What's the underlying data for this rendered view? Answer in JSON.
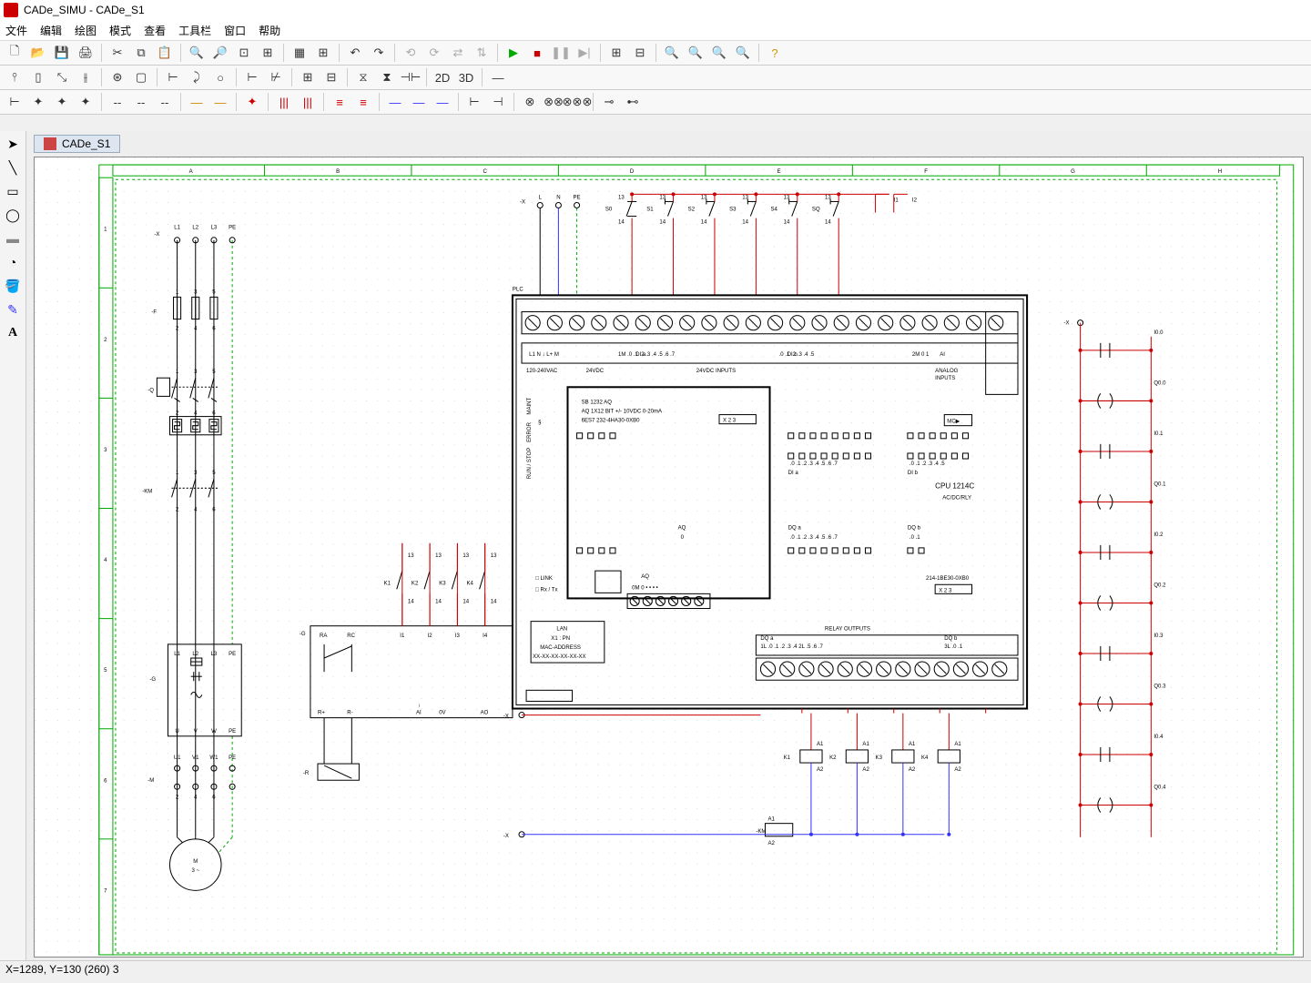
{
  "window_title": "CADe_SIMU - CADe_S1",
  "menu": [
    "文件",
    "编辑",
    "绘图",
    "模式",
    "查看",
    "工具栏",
    "窗口",
    "帮助"
  ],
  "doc_tab": "CADe_S1",
  "status": "X=1289, Y=130 (260) 3",
  "ruler_cols": [
    "A",
    "B",
    "C",
    "D",
    "E",
    "F",
    "G",
    "H"
  ],
  "ruler_rows": [
    "1",
    "2",
    "3",
    "4",
    "5",
    "6",
    "7"
  ],
  "power": {
    "conn": "-X",
    "phases": [
      "L1",
      "L2",
      "L3",
      "PE"
    ],
    "fuse_top": [
      "1",
      "3",
      "5"
    ],
    "fuse_bot": [
      "2",
      "4",
      "6"
    ],
    "fuse_lbl": "-F",
    "breaker_lbl": "-Q",
    "breaker_top": [
      "1",
      "3",
      "5"
    ],
    "breaker_bot": [
      "2",
      "4",
      "6"
    ],
    "km_lbl": "-KM",
    "km_top": [
      "1",
      "3",
      "5"
    ],
    "km_bot": [
      "2",
      "4",
      "6"
    ],
    "vfd_in": [
      "L1",
      "L2",
      "L3",
      "PE"
    ],
    "vfd_out": [
      "U",
      "V",
      "W",
      "PE"
    ],
    "vfd_lbl": "-G",
    "motor_u": [
      "U1",
      "V1",
      "W1",
      "PE"
    ],
    "motor_b": [
      "2",
      "4",
      "6"
    ],
    "motor_lbl": "-M",
    "motor_txt": "M\n3 ~"
  },
  "vfd_ctrl": {
    "lbl": "-G",
    "k_left": [
      "K1",
      "K2",
      "K3",
      "K4"
    ],
    "k_t": "13",
    "k_b": "14",
    "term_l": [
      "RA",
      "RC"
    ],
    "term_r": [
      "I1",
      "I2",
      "I3",
      "I4"
    ],
    "out_l": [
      "R+",
      "R-"
    ],
    "out_r": [
      "AI",
      "0V",
      "AO"
    ],
    "ai_arrow": "↓",
    "bot_lbl": "-R"
  },
  "plc_power": {
    "conn": "-X",
    "labels": [
      "L",
      "N",
      "PE"
    ]
  },
  "plc_inputs": {
    "switches": [
      "S0",
      "S1",
      "S2",
      "S3",
      "S4",
      "SQ"
    ],
    "pin_t": "13",
    "pin_b": "14",
    "right": [
      "I1",
      "I2"
    ]
  },
  "plc": {
    "lbl": "PLC",
    "power_row": [
      "L1",
      "N",
      "↓",
      "L+",
      "M"
    ],
    "power_l": "120-240VAC",
    "power_r": "24VDC",
    "di_hdr": "24VDC INPUTS",
    "dia": "DI a",
    "dib": "DI b",
    "di_a": [
      "1M",
      ".0",
      ".1",
      ".2",
      ".3",
      ".4",
      ".5",
      ".6",
      ".7"
    ],
    "di_b": [
      ".0",
      ".1",
      ".2",
      ".3",
      ".4",
      ".5"
    ],
    "ai_hdr": "ANALOG\nINPUTS",
    "ai": [
      "2M",
      "0",
      "1"
    ],
    "ai_lbl": "AI",
    "sb_title": "SB 1232 AQ",
    "sb_l2": "AQ 1X12 BIT +/- 10VDC 0-20mA",
    "sb_l3": "6ES7 232-4HA30-0XB0",
    "sb_x23": "X 2 3",
    "side": "RUN / STOP\nERROR\nMAINT",
    "cpu": "CPU 1214C",
    "cpu2": "AC/DC/RLY",
    "mc": "MC▶",
    "dia2": "DI a",
    "dib2": "DI b",
    "dia2_p": [
      ".0",
      ".1",
      ".2",
      ".3",
      ".4",
      ".5",
      ".6",
      ".7"
    ],
    "dib2_p": [
      ".0",
      ".1",
      ".2",
      ".3",
      ".4",
      ".5"
    ],
    "dqa": "DQ a",
    "dqb": "DQ b",
    "dqa_p": [
      ".0",
      ".1",
      ".2",
      ".3",
      ".4",
      ".5",
      ".6",
      ".7"
    ],
    "dqb_p": [
      ".0",
      ".1"
    ],
    "aq": "AQ",
    "aq0": "0",
    "link": "□ LINK",
    "rxtx": "□ Rx / Tx",
    "aq_row": [
      "0M",
      "0",
      "•",
      "•",
      "•",
      "•"
    ],
    "part": "214-1BE30-0XB0",
    "x23b": "X 2 3",
    "lan": "LAN",
    "x1": "X1 : PN",
    "mac": "MAC-ADDRESS",
    "macv": "XX-XX-XX-XX-XX-XX",
    "relay": "RELAY OUTPUTS",
    "dqa2": "DQ a",
    "dqb2": "DQ b",
    "dqa2_p": [
      "1L",
      ".0",
      ".1",
      ".2",
      ".3",
      ".4",
      "2L",
      ".5",
      ".6",
      ".7"
    ],
    "dqb2_p": [
      "3L",
      ".0",
      ".1"
    ]
  },
  "outputs": {
    "x1": "-X",
    "x2": "-X",
    "relays": [
      "K1",
      "K2",
      "K3",
      "K4"
    ],
    "a1": "A1",
    "a2": "A2",
    "km": "-KM"
  },
  "ladder": {
    "x": "-X",
    "i": [
      "I0.0",
      "I0.1",
      "I0.2",
      "I0.3",
      "I0.4"
    ],
    "q": [
      "Q0.0",
      "Q0.1",
      "Q0.2",
      "Q0.3",
      "Q0.4"
    ]
  }
}
